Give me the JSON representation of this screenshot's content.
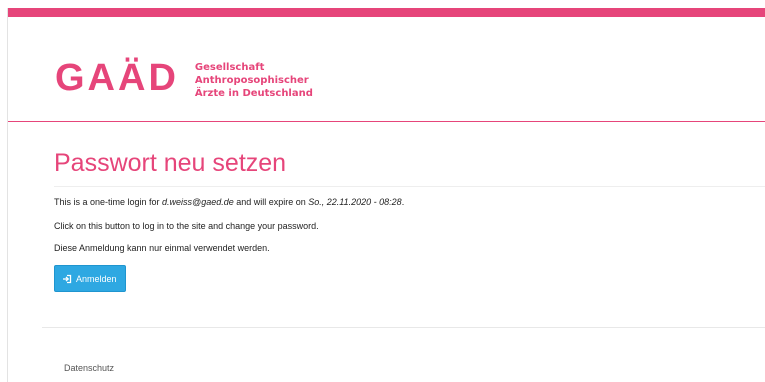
{
  "colors": {
    "brand": "#e6457a",
    "button": "#2ea8e2"
  },
  "logo": {
    "mark": "GAÄD",
    "text_lines": [
      "Gesellschaft",
      "Anthroposophischer",
      "Ärzte in Deutschland"
    ]
  },
  "page": {
    "title": "Passwort neu setzen"
  },
  "message": {
    "line1_prefix": "This is a one-time login for ",
    "email": "d.weiss@gaed.de",
    "line1_middle": " and will expire on ",
    "expiry": "So., 22.11.2020 - 08:28",
    "line1_suffix": ".",
    "line2": "Click on this button to log in to the site and change your password.",
    "line3": "Diese Anmeldung kann nur einmal verwendet werden."
  },
  "login_button": {
    "label": "Anmelden",
    "icon": "sign-in-icon"
  },
  "footer": {
    "link": "Datenschutz"
  }
}
